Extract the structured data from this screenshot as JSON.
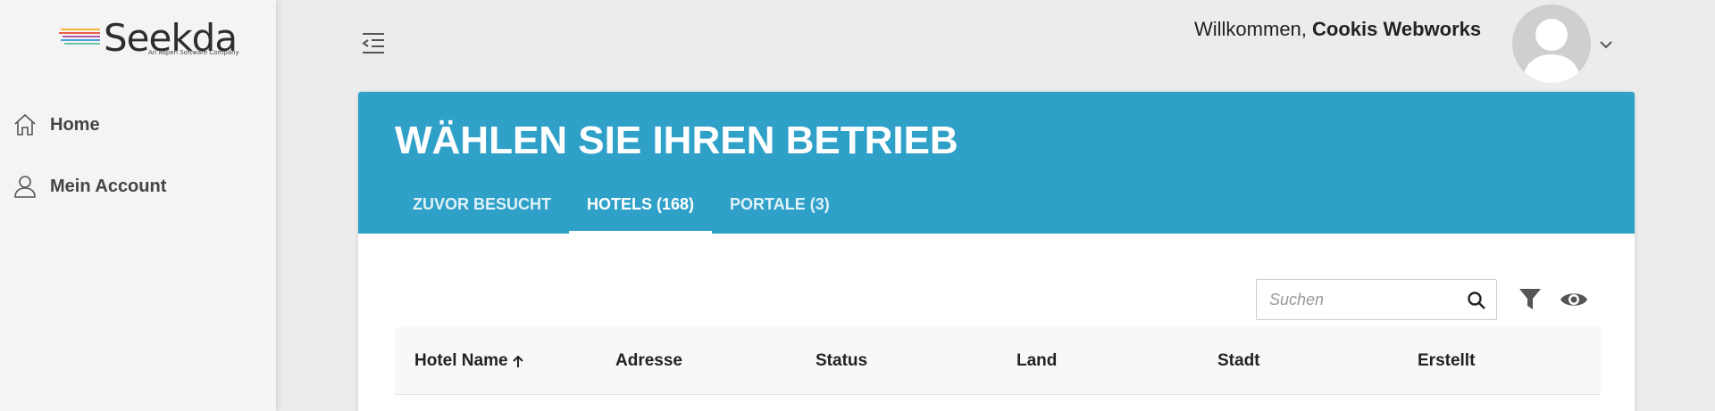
{
  "sidebar": {
    "logo": {
      "word": "Seekda",
      "subtitle": "An Aspen Software Company"
    },
    "items": [
      {
        "label": "Home",
        "icon": "home-icon"
      },
      {
        "label": "Mein Account",
        "icon": "user-icon"
      }
    ]
  },
  "header": {
    "welcome_prefix": "Willkommen, ",
    "user_name": "Cookis Webworks"
  },
  "card": {
    "title": "WÄHLEN SIE IHREN BETRIEB",
    "tabs": [
      {
        "label": "ZUVOR BESUCHT",
        "active": false
      },
      {
        "label": "HOTELS (168)",
        "active": true
      },
      {
        "label": "PORTALE (3)",
        "active": false
      }
    ]
  },
  "toolbar": {
    "search_placeholder": "Suchen"
  },
  "table": {
    "columns": [
      "Hotel Name",
      "Adresse",
      "Status",
      "Land",
      "Stadt",
      "Erstellt"
    ],
    "sorted_column": "Hotel Name",
    "sort_direction": "ascending"
  },
  "colors": {
    "accent": "#2fa1c9",
    "sidebar_bg": "#f4f4f4",
    "page_bg": "#ececec"
  }
}
